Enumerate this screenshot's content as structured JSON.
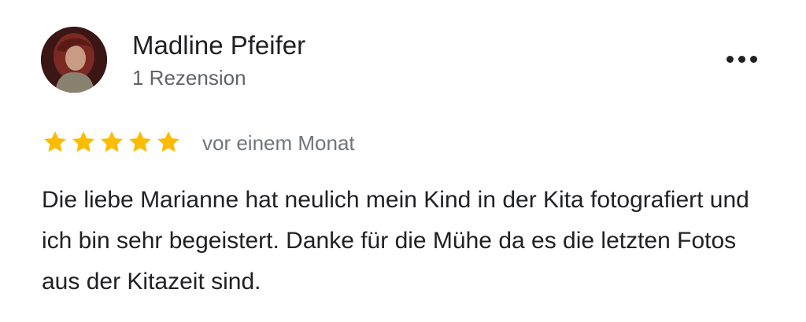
{
  "review": {
    "author_name": "Madline Pfeifer",
    "review_count": "1 Rezension",
    "rating": 5,
    "rating_max": 5,
    "time_ago": "vor einem Monat",
    "text": "Die liebe Marianne hat neulich mein Kind in der Kita fotografiert und ich bin sehr begeistert. Danke für die Mühe da es die letzten Fotos aus der Kitazeit sind."
  },
  "icons": {
    "more": "more-horizontal-icon",
    "star": "star-icon"
  },
  "colors": {
    "star_filled": "#fbbc04",
    "name": "#202124",
    "secondary_text": "#5f6368"
  }
}
